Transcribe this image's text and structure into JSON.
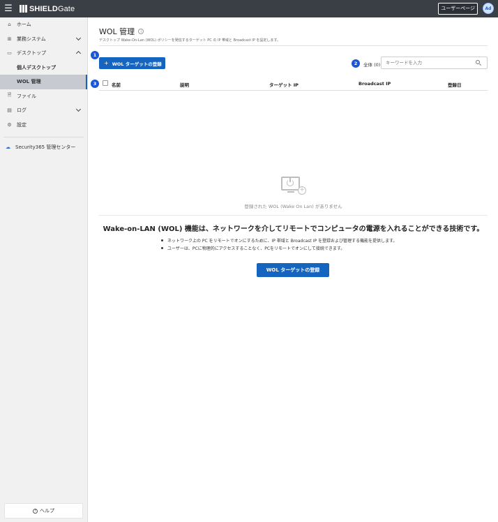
{
  "header": {
    "menu_icon": "hamburger-icon",
    "logo_bold": "SHIELD",
    "logo_regular": "Gate",
    "mypage_label": "ユーザーページ",
    "avatar_initials": "Ad"
  },
  "sidebar": {
    "items": [
      {
        "label": "ホーム",
        "icon": "home-icon"
      },
      {
        "label": "業務システム",
        "icon": "grid-icon"
      },
      {
        "label": "デスクトップ",
        "icon": "monitor-icon"
      },
      {
        "label": "個人デスクトップ"
      },
      {
        "label": "WOL 管理"
      },
      {
        "label": "ファイル",
        "icon": "file-icon"
      },
      {
        "label": "ログ",
        "icon": "log-icon"
      },
      {
        "label": "設定",
        "icon": "gear-icon"
      }
    ],
    "security_link": "Security365 管理センター",
    "help_label": "ヘルプ"
  },
  "page": {
    "title": "WOL 管理",
    "description": "デスクトップ Wake-On-Lan (WOL) ポリシーを発信するターゲット PC の IP 帯域と Broadcast IP を設定します。"
  },
  "toolbar": {
    "add_button_label": "WOL ターゲットの登録",
    "total_label": "全体 (0)",
    "search_placeholder": "キーワードを入力"
  },
  "badges": [
    "1",
    "2",
    "3"
  ],
  "table": {
    "columns": [
      "名前",
      "説明",
      "ターゲット IP",
      "Broadcast IP",
      "登録日"
    ]
  },
  "empty_state": {
    "message": "登録された WOL (Wake On Lan) がありません",
    "headline": "Wake-on-LAN (WOL) 機能は、ネットワークを介してリモートでコンピュータの電源を入れることができる技術です。",
    "bullets": [
      "ネットワーク上の PC をリモートでオンにするために、IP 帯域と Broadcast IP を登録および管理する機能を提供します。",
      "ユーザーは、PCに物理的にアクセスすることなく、PCをリモートでオンにして接続できます。"
    ],
    "button_label": "WOL ターゲットの登録"
  },
  "colors": {
    "topbar": "#3a3e45",
    "primary": "#1565c0",
    "badge": "#1a56d6",
    "sidebar_bg": "#f1f1f1",
    "sidebar_active": "#c7cbd1"
  }
}
